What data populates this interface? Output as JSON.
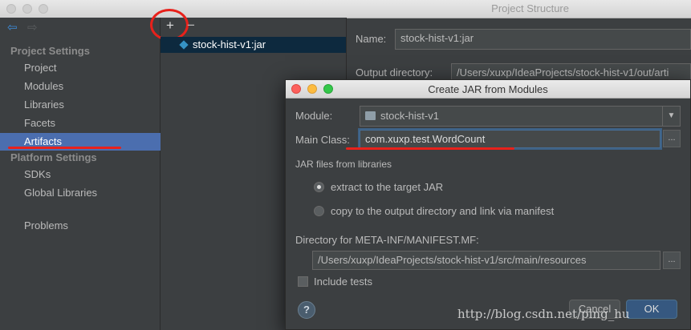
{
  "window": {
    "title": "Project Structure"
  },
  "sidebar": {
    "project_settings_header": "Project Settings",
    "items": [
      {
        "label": "Project"
      },
      {
        "label": "Modules"
      },
      {
        "label": "Libraries"
      },
      {
        "label": "Facets"
      },
      {
        "label": "Artifacts"
      }
    ],
    "platform_settings_header": "Platform Settings",
    "platform_items": [
      {
        "label": "SDKs"
      },
      {
        "label": "Global Libraries"
      }
    ],
    "problems_label": "Problems"
  },
  "artifacts_list": {
    "add_symbol": "+",
    "remove_symbol": "−",
    "items": [
      {
        "label": "stock-hist-v1:jar"
      }
    ]
  },
  "details": {
    "name_label": "Name:",
    "name_value": "stock-hist-v1:jar",
    "output_dir_label": "Output directory:",
    "output_dir_value": "/Users/xuxp/IdeaProjects/stock-hist-v1/out/arti"
  },
  "dialog": {
    "title": "Create JAR from Modules",
    "module_label": "Module:",
    "module_value": "stock-hist-v1",
    "main_class_label": "Main Class:",
    "main_class_value": "com.xuxp.test.WordCount",
    "browse_symbol": "...",
    "jar_files_header": "JAR files from libraries",
    "option_extract": "extract to the target JAR",
    "option_copy": "copy to the output directory and link via manifest",
    "selected_option": "extract",
    "manifest_dir_label": "Directory for META-INF/MANIFEST.MF:",
    "manifest_dir_value": "/Users/xuxp/IdeaProjects/stock-hist-v1/src/main/resources",
    "include_tests_label": "Include tests",
    "include_tests_checked": false,
    "help_symbol": "?",
    "cancel_label": "Cancel",
    "ok_label": "OK"
  },
  "watermark": "http://blog.csdn.net/ping_hu",
  "colors": {
    "selection": "#4b6eaf",
    "list_selection": "#0d293e",
    "annotation": "#e8211b",
    "accent_diamond": "#3592c4"
  }
}
